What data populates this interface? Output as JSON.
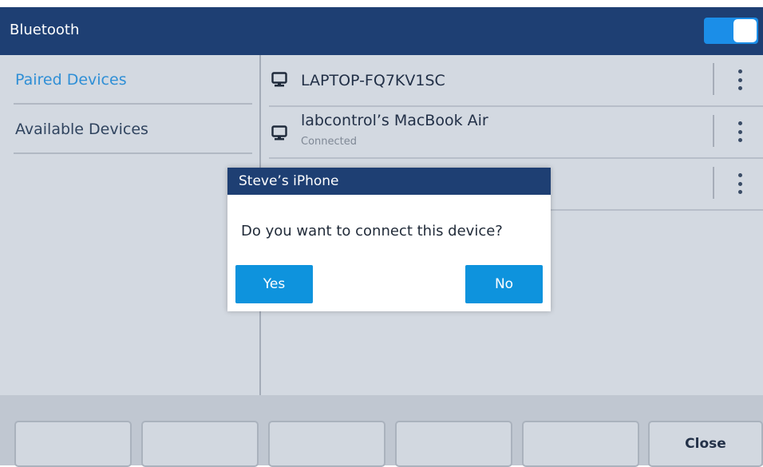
{
  "header": {
    "title": "Bluetooth",
    "toggle_on": true
  },
  "sidebar": {
    "items": [
      {
        "label": "Paired Devices",
        "active": true
      },
      {
        "label": "Available Devices",
        "active": false
      }
    ]
  },
  "devices": [
    {
      "name": "LAPTOP-FQ7KV1SC",
      "status": "",
      "icon": "computer-icon"
    },
    {
      "name": "labcontrol’s MacBook Air",
      "status": "Connected",
      "icon": "computer-icon"
    },
    {
      "name": "",
      "status": "",
      "icon": ""
    }
  ],
  "dialog": {
    "title": "Steve’s iPhone",
    "message": "Do you want to connect this device?",
    "yes_label": "Yes",
    "no_label": "No"
  },
  "softkeys": [
    "",
    "",
    "",
    "",
    "",
    "Close"
  ],
  "colors": {
    "header_bg": "#1e3f73",
    "accent": "#0e93dd",
    "active_tab_text": "#2f8fd6",
    "screen_bg": "#d3d9e1"
  }
}
